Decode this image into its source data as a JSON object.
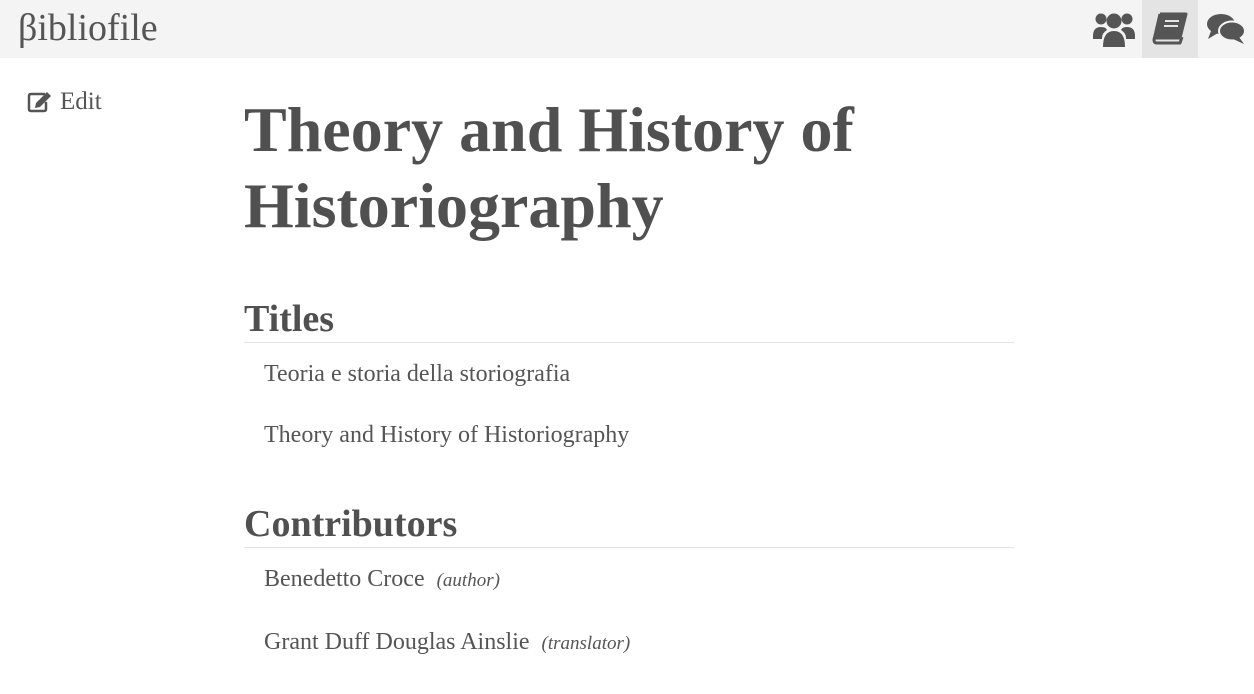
{
  "navbar": {
    "brand": "βibliofile",
    "icons": [
      {
        "name": "users-icon",
        "active": false
      },
      {
        "name": "book-icon",
        "active": true
      },
      {
        "name": "comments-icon",
        "active": false
      }
    ]
  },
  "sidebar": {
    "edit_label": "Edit",
    "edit_icon": "edit-icon"
  },
  "main": {
    "title": "Theory and History of Historiography",
    "titles_heading": "Titles",
    "titles": [
      "Teoria e storia della storiografia",
      "Theory and History of Historiography"
    ],
    "contributors_heading": "Contributors",
    "contributors": [
      {
        "name": "Benedetto Croce",
        "role": "(author)"
      },
      {
        "name": "Grant Duff Douglas Ainslie",
        "role": "(translator)"
      }
    ]
  },
  "colors": {
    "navbar_bg": "#f4f4f4",
    "active_nav_bg": "#e4e4e4",
    "text": "#555555"
  }
}
